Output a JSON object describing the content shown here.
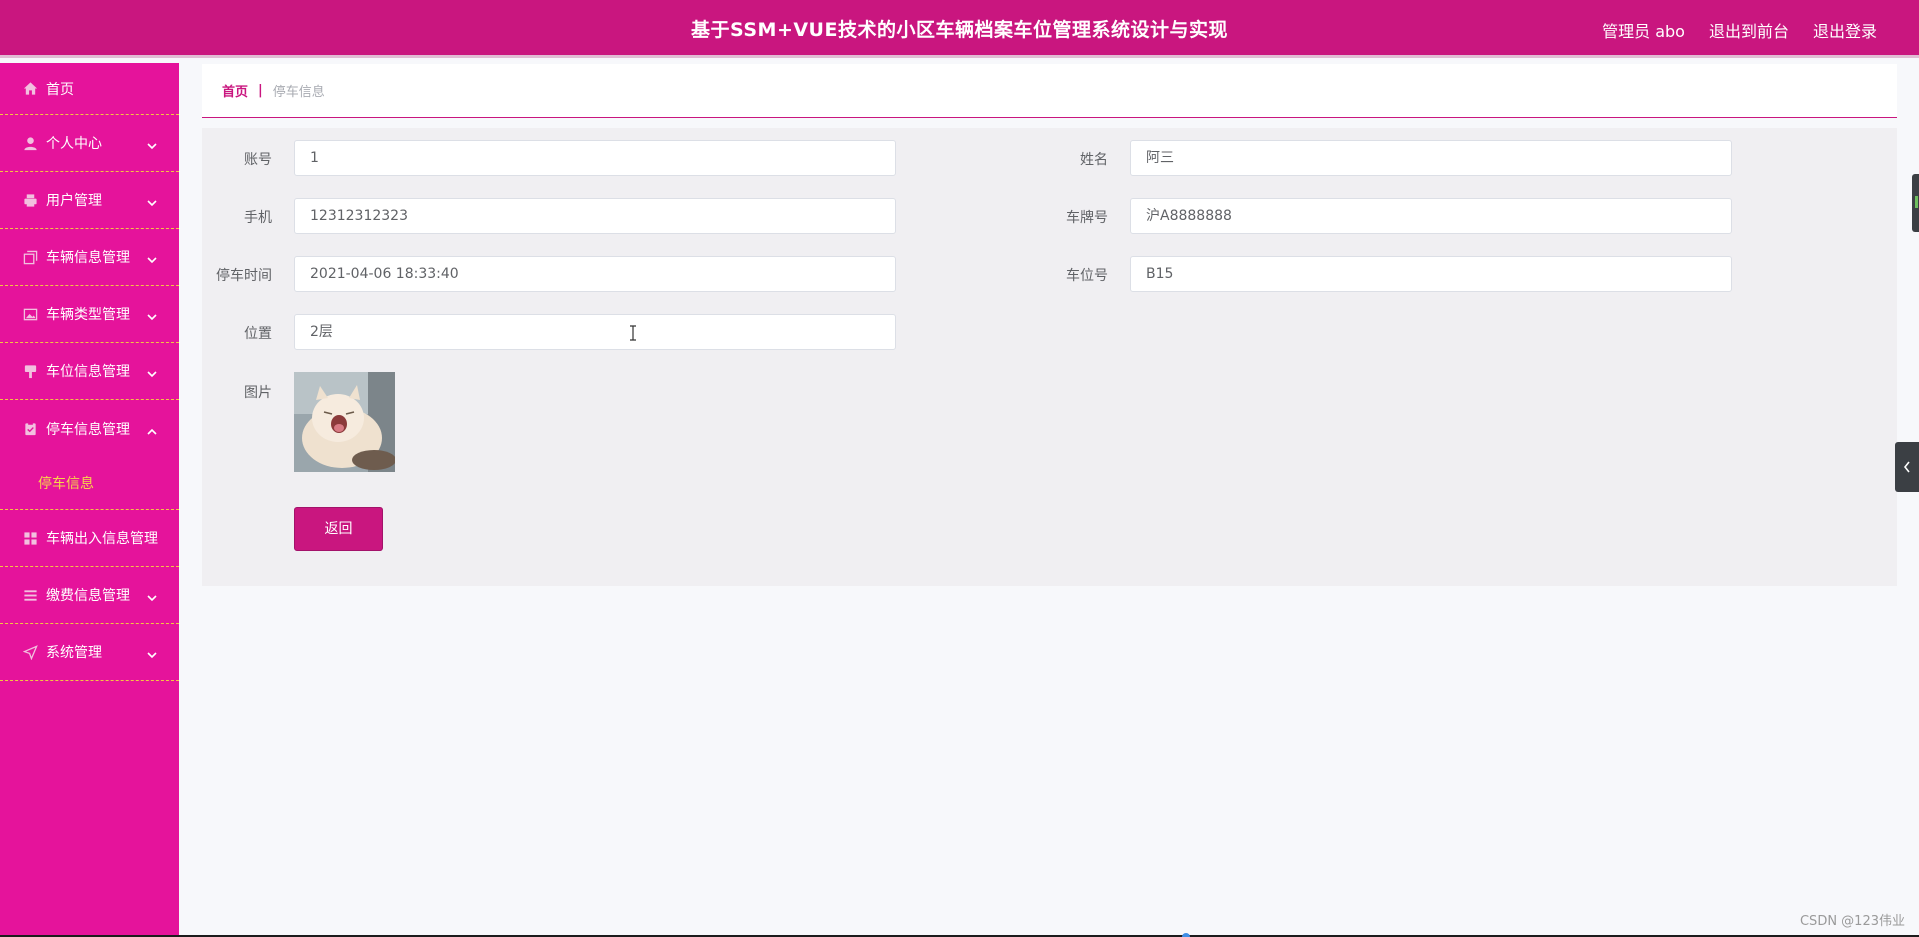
{
  "header": {
    "title": "基于SSM+VUE技术的小区车辆档案车位管理系统设计与实现",
    "user": "管理员 abo",
    "front_link": "退出到前台",
    "logout": "退出登录"
  },
  "sidebar": {
    "items": [
      {
        "label": "首页",
        "icon": "home-icon"
      },
      {
        "label": "个人中心",
        "icon": "user-icon"
      },
      {
        "label": "用户管理",
        "icon": "printer-icon"
      },
      {
        "label": "车辆信息管理",
        "icon": "copy-icon"
      },
      {
        "label": "车辆类型管理",
        "icon": "picture-icon"
      },
      {
        "label": "车位信息管理",
        "icon": "stamp-icon"
      },
      {
        "label": "停车信息管理",
        "icon": "clipboard-icon",
        "sub": "停车信息"
      },
      {
        "label": "车辆出入信息管理",
        "icon": "grid-icon"
      },
      {
        "label": "缴费信息管理",
        "icon": "menu-icon"
      },
      {
        "label": "系统管理",
        "icon": "send-icon"
      }
    ]
  },
  "breadcrumb": {
    "home": "首页",
    "separator": "|",
    "current": "停车信息"
  },
  "form": {
    "account_label": "账号",
    "account_value": "1",
    "name_label": "姓名",
    "name_value": "阿三",
    "phone_label": "手机",
    "phone_value": "12312312323",
    "plate_label": "车牌号",
    "plate_value": "沪A8888888",
    "time_label": "停车时间",
    "time_value": "2021-04-06 18:33:40",
    "space_label": "车位号",
    "space_value": "B15",
    "location_label": "位置",
    "location_value": "2层",
    "image_label": "图片",
    "back_button": "返回"
  },
  "watermark": "CSDN @123伟业",
  "colors": {
    "primary": "#c9167f",
    "sidebar": "#e5139b",
    "divider": "#f5c542",
    "active_sub": "#f7d64a"
  }
}
